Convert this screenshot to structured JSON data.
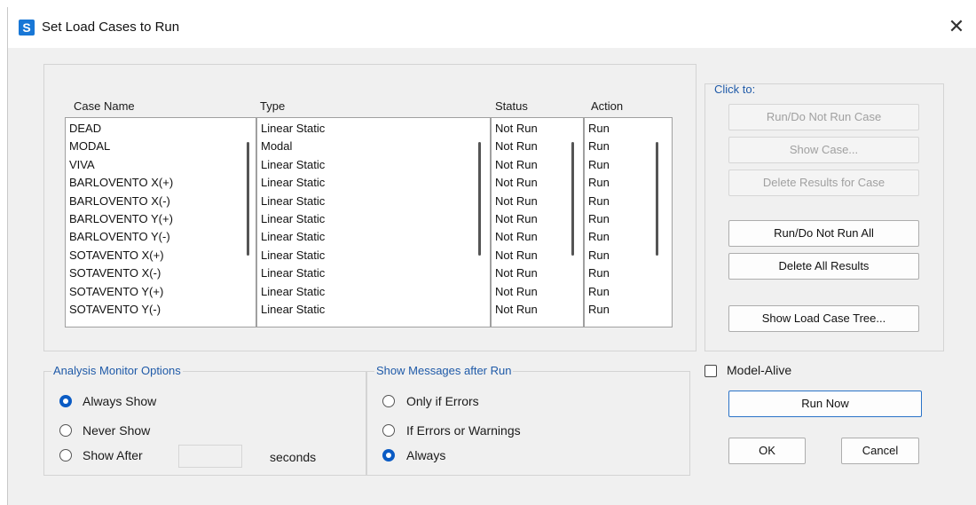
{
  "window": {
    "title": "Set Load Cases to Run",
    "icon_letter": "S",
    "close_glyph": "✕"
  },
  "table": {
    "headers": {
      "case_name": "Case Name",
      "type": "Type",
      "status": "Status",
      "action": "Action"
    },
    "rows": [
      {
        "case_name": "DEAD",
        "type": "Linear Static",
        "status": "Not Run",
        "action": "Run"
      },
      {
        "case_name": "MODAL",
        "type": "Modal",
        "status": "Not Run",
        "action": "Run"
      },
      {
        "case_name": "VIVA",
        "type": "Linear Static",
        "status": "Not Run",
        "action": "Run"
      },
      {
        "case_name": "BARLOVENTO X(+)",
        "type": "Linear Static",
        "status": "Not Run",
        "action": "Run"
      },
      {
        "case_name": "BARLOVENTO X(-)",
        "type": "Linear Static",
        "status": "Not Run",
        "action": "Run"
      },
      {
        "case_name": "BARLOVENTO Y(+)",
        "type": "Linear Static",
        "status": "Not Run",
        "action": "Run"
      },
      {
        "case_name": "BARLOVENTO Y(-)",
        "type": "Linear Static",
        "status": "Not Run",
        "action": "Run"
      },
      {
        "case_name": "SOTAVENTO X(+)",
        "type": "Linear Static",
        "status": "Not Run",
        "action": "Run"
      },
      {
        "case_name": "SOTAVENTO X(-)",
        "type": "Linear Static",
        "status": "Not Run",
        "action": "Run"
      },
      {
        "case_name": "SOTAVENTO Y(+)",
        "type": "Linear Static",
        "status": "Not Run",
        "action": "Run"
      },
      {
        "case_name": "SOTAVENTO Y(-)",
        "type": "Linear Static",
        "status": "Not Run",
        "action": "Run"
      }
    ]
  },
  "click_to": {
    "label": "Click to:",
    "run_do_not_run_case": "Run/Do Not Run Case",
    "show_case": "Show Case...",
    "delete_results_for_case": "Delete Results for Case",
    "run_do_not_run_all": "Run/Do Not Run All",
    "delete_all_results": "Delete All Results",
    "show_load_case_tree": "Show Load Case Tree..."
  },
  "analysis_monitor": {
    "label": "Analysis Monitor Options",
    "always_show": "Always Show",
    "never_show": "Never Show",
    "show_after": "Show After",
    "seconds": "seconds",
    "selected": "always_show",
    "show_after_value": ""
  },
  "messages": {
    "label": "Show Messages after Run",
    "only_if_errors": "Only if Errors",
    "if_errors_or_warnings": "If Errors or Warnings",
    "always": "Always",
    "selected": "always"
  },
  "model_alive": {
    "label": "Model-Alive",
    "checked": false
  },
  "actions": {
    "run_now": "Run Now",
    "ok": "OK",
    "cancel": "Cancel"
  },
  "colors": {
    "accent": "#0a5bc4",
    "group_label": "#1f5aa8"
  }
}
